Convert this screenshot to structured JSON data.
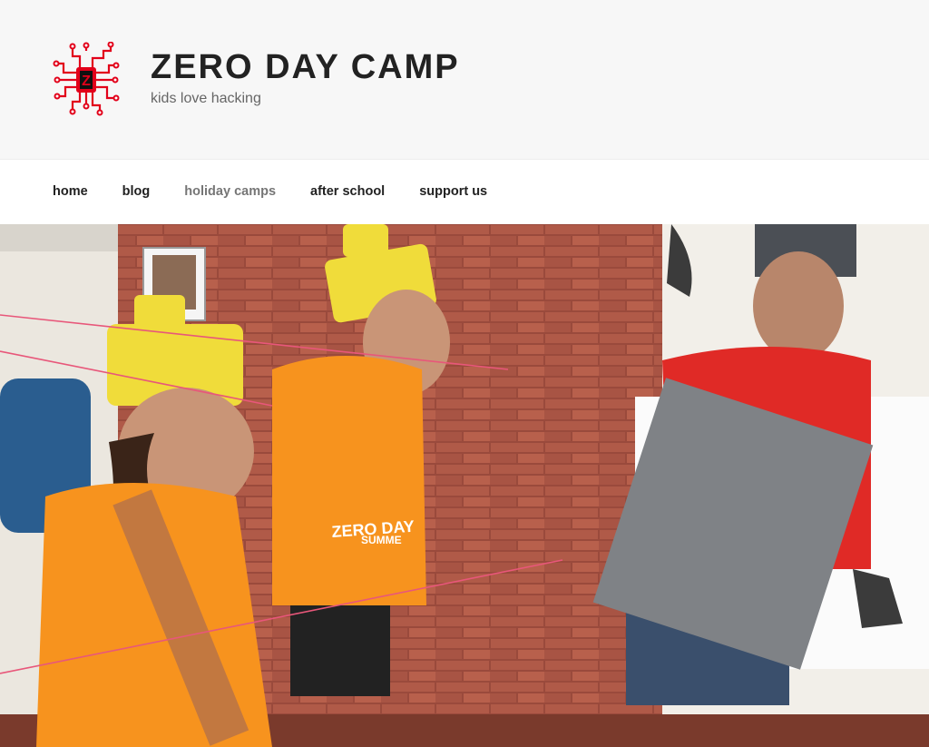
{
  "site": {
    "title": "ZERO DAY CAMP",
    "description": "kids love hacking",
    "logo_icon": "circuit-chip-z-logo",
    "logo_letter": "Z",
    "accent": "#e2001a"
  },
  "nav": {
    "items": [
      {
        "label": "home"
      },
      {
        "label": "blog"
      },
      {
        "label": "holiday camps",
        "current": true
      },
      {
        "label": "after school"
      },
      {
        "label": "support us"
      }
    ]
  },
  "hero": {
    "shirt_text_1": "ZERO DAY",
    "shirt_text_2": "SUMME",
    "shirt_text_3": "ZERO"
  }
}
